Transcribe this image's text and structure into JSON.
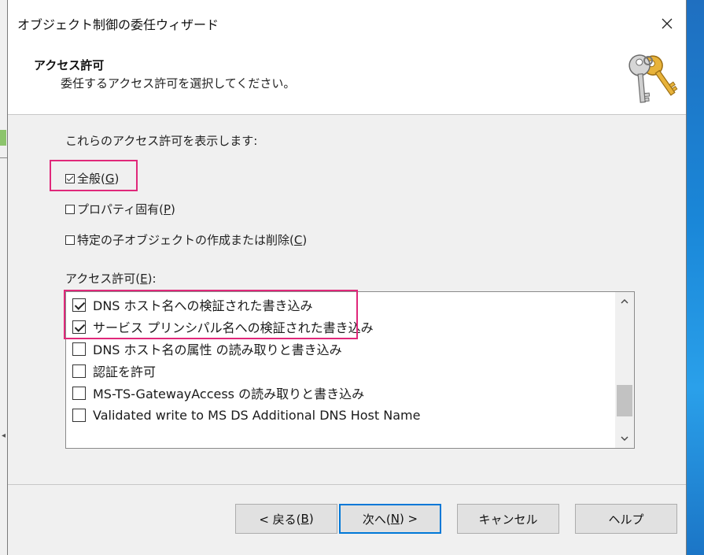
{
  "window": {
    "title": "オブジェクト制御の委任ウィザード"
  },
  "header": {
    "title": "アクセス許可",
    "subtitle": "委任するアクセス許可を選択してください。"
  },
  "show_section": {
    "label": "これらのアクセス許可を表示します:",
    "options": [
      {
        "text": "全般",
        "mnemonic": "G",
        "checked": true
      },
      {
        "text": "プロパティ固有",
        "mnemonic": "P",
        "checked": false
      },
      {
        "text": "特定の子オブジェクトの作成または削除",
        "mnemonic": "C",
        "checked": false
      }
    ]
  },
  "permissions": {
    "label": "アクセス許可",
    "mnemonic": "E",
    "label_suffix": ":",
    "items": [
      {
        "text": "DNS ホスト名への検証された書き込み",
        "checked": true
      },
      {
        "text": "サービス プリンシパル名への検証された書き込み",
        "checked": true
      },
      {
        "text": "DNS ホスト名の属性 の読み取りと書き込み",
        "checked": false
      },
      {
        "text": "認証を許可",
        "checked": false
      },
      {
        "text": "MS-TS-GatewayAccess の読み取りと書き込み",
        "checked": false
      },
      {
        "text": "Validated write to MS DS Additional DNS Host Name",
        "checked": false
      }
    ],
    "scroll_position": 0.85
  },
  "buttons": {
    "back": {
      "prefix": "< 戻る(",
      "mnemonic": "B",
      "suffix": ")"
    },
    "next": {
      "prefix": "次へ(",
      "mnemonic": "N",
      "suffix": ") >"
    },
    "cancel": "キャンセル",
    "help": "ヘルプ"
  },
  "colors": {
    "highlight": "#e0287a",
    "default_button_border": "#0078d7"
  }
}
